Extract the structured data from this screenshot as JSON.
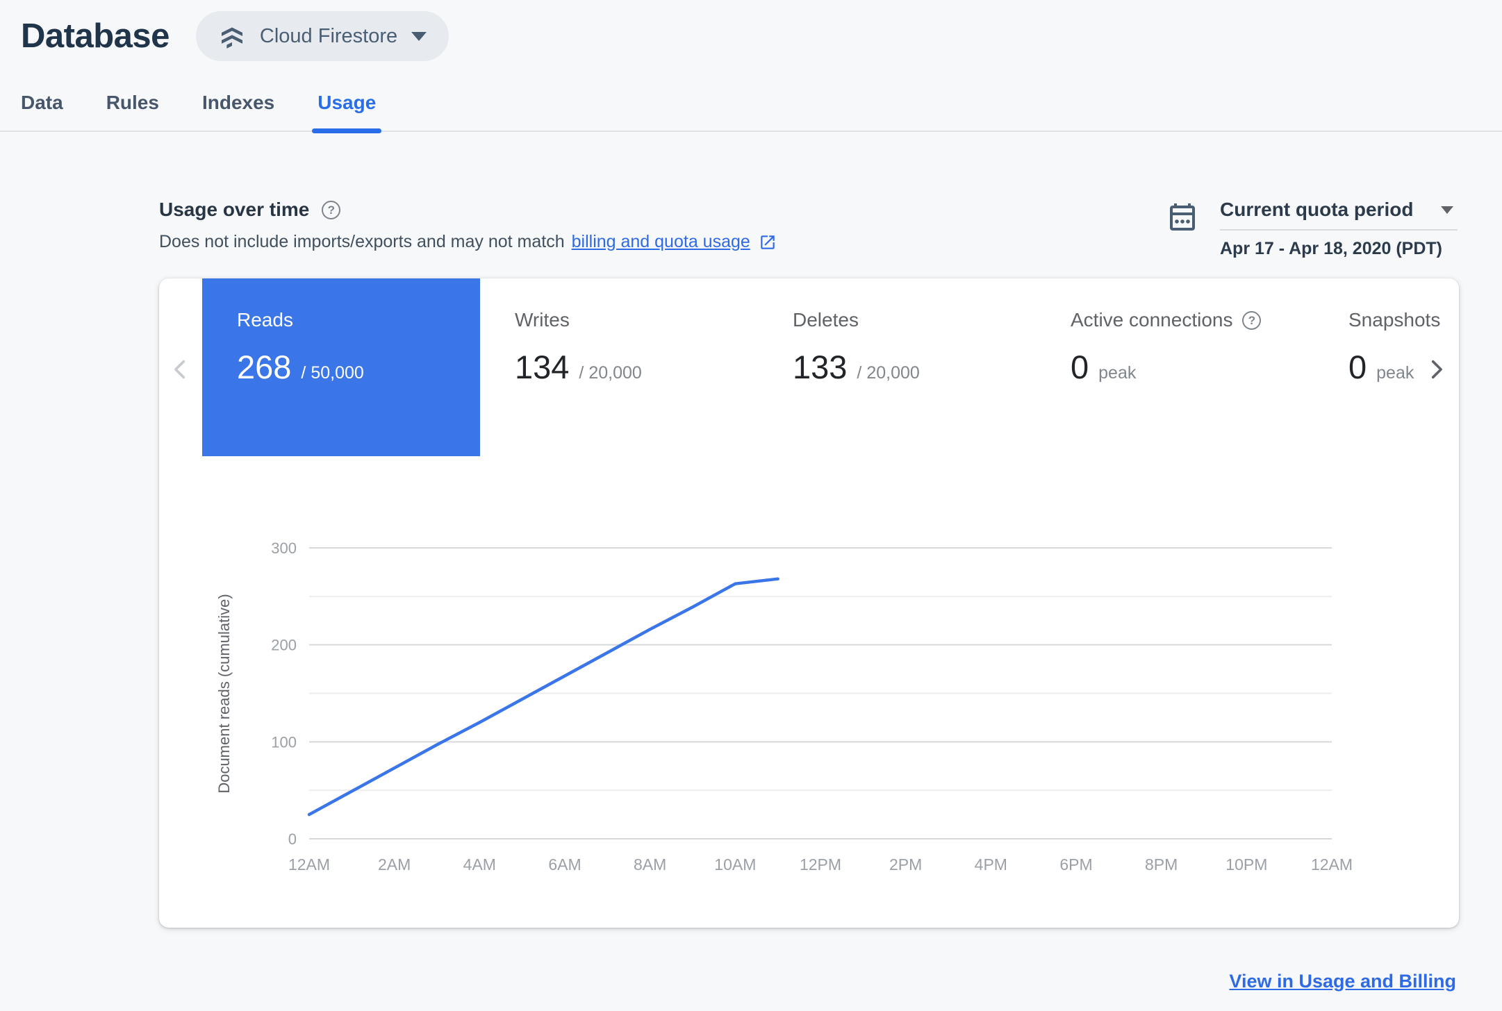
{
  "header": {
    "title": "Database",
    "product_selector": {
      "label": "Cloud Firestore"
    }
  },
  "tabs": [
    {
      "label": "Data"
    },
    {
      "label": "Rules"
    },
    {
      "label": "Indexes"
    },
    {
      "label": "Usage"
    }
  ],
  "usage": {
    "title": "Usage over time",
    "subtitle_prefix": "Does not include imports/exports and may not match",
    "subtitle_link": "billing and quota usage",
    "quota_period_label": "Current quota period",
    "quota_period_range": "Apr 17 - Apr 18, 2020 (PDT)"
  },
  "metric_cards": [
    {
      "label": "Reads",
      "value": "268",
      "suffix": "/ 50,000"
    },
    {
      "label": "Writes",
      "value": "134",
      "suffix": "/ 20,000"
    },
    {
      "label": "Deletes",
      "value": "133",
      "suffix": "/ 20,000"
    },
    {
      "label": "Active connections",
      "value": "0",
      "suffix": "peak"
    },
    {
      "label": "Snapshots",
      "value": "0",
      "suffix": "peak"
    }
  ],
  "footer_link": "View in Usage and Billing",
  "colors": {
    "accent_blue": "#3b76e8",
    "tab_active_blue": "#2a6de8",
    "link_blue": "#2f6ae6",
    "selected_card_bg": "#3b76e8",
    "grid_major": "#d6d9dc",
    "grid_minor": "#ededee",
    "axis_text": "#9aa0a6",
    "panel_bg": "#ffffff",
    "page_bg": "#f7f8f9"
  },
  "chart_data": {
    "type": "line",
    "title": "",
    "xlabel": "",
    "ylabel": "Document reads (cumulative)",
    "x_labels": [
      "12AM",
      "2AM",
      "4AM",
      "6AM",
      "8AM",
      "10AM",
      "12PM",
      "2PM",
      "4PM",
      "6PM",
      "8PM",
      "10PM",
      "12AM"
    ],
    "x_hours_span": 24,
    "ylim": [
      0,
      300
    ],
    "grid_step": 50,
    "y_ticks_labeled": [
      0,
      100,
      200,
      300
    ],
    "legend": "none",
    "series": [
      {
        "name": "Document reads (cumulative)",
        "color": "#3b76e8",
        "points": [
          [
            0,
            25
          ],
          [
            1,
            49
          ],
          [
            2,
            73
          ],
          [
            3,
            97
          ],
          [
            4,
            120
          ],
          [
            5,
            144
          ],
          [
            6,
            168
          ],
          [
            7,
            192
          ],
          [
            8,
            216
          ],
          [
            9,
            239
          ],
          [
            10,
            263
          ],
          [
            11,
            268
          ]
        ]
      }
    ]
  }
}
